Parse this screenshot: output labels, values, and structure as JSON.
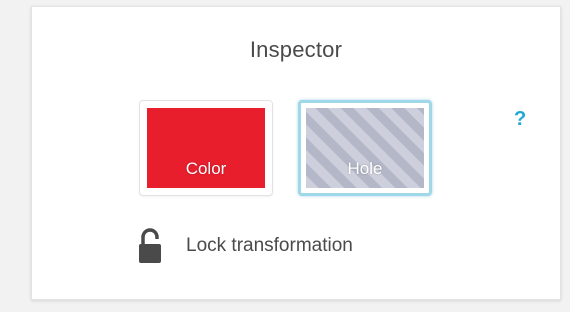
{
  "inspector": {
    "title": "Inspector",
    "help_label": "?",
    "color_option": {
      "label": "Color",
      "fill_color": "#e81e2d"
    },
    "hole_option": {
      "label": "Hole",
      "selected": true,
      "accent": "#9fd8e8"
    },
    "lock": {
      "label": "Lock transformation",
      "icon": "unlocked-padlock-icon",
      "locked": false
    }
  },
  "colors": {
    "accent": "#23a7d3",
    "text": "#4a4a4a"
  }
}
